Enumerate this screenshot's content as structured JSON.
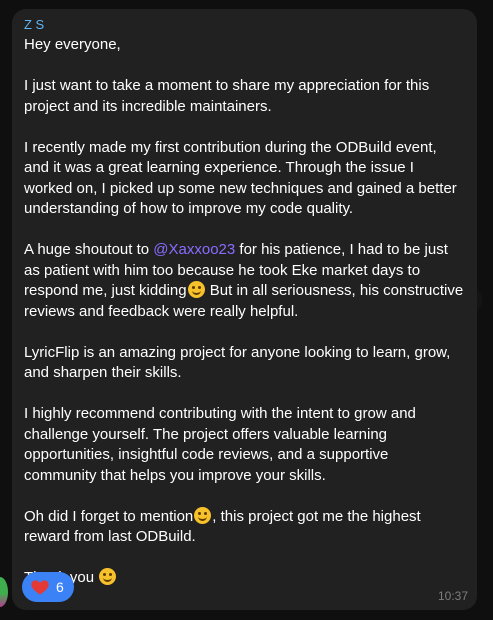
{
  "message": {
    "sender": "Z S",
    "paragraphs": {
      "p1": "Hey everyone,",
      "p2": "I just want to take a moment to share my appreciation for this project and its incredible maintainers.",
      "p3": "I recently made my first contribution during the ODBuild event, and it was a great learning experience. Through the issue I worked on, I picked up some new techniques and gained a better understanding of how to improve my code quality.",
      "p4_before": "A huge shoutout to ",
      "p4_mention": "@Xaxxoo23",
      "p4_middle": " for his patience, I had to be just as patient with him too because he took Eke market days to respond me, just kidding",
      "p4_after": " But in all seriousness, his constructive reviews and feedback were really helpful.",
      "p5": "LyricFlip is an amazing project for anyone looking to learn, grow, and sharpen their skills.",
      "p6": "I highly recommend contributing with the intent to grow and challenge yourself. The project offers valuable learning opportunities, insightful code reviews, and a supportive community that helps you improve your skills.",
      "p7_before": "Oh did I forget to mention",
      "p7_after": ", this project got me the highest reward from last ODBuild.",
      "p8": "Thank you "
    },
    "emojis": [
      "laughing-emoji",
      "hush-emoji",
      "smile-emoji"
    ],
    "reaction": {
      "icon": "heart-icon",
      "count": "6"
    },
    "time": "10:37"
  },
  "colors": {
    "background": "#0f0f0f",
    "bubble": "#212121",
    "sender": "#5eb5f7",
    "mention": "#8b6cff",
    "reaction": "#3b82f6",
    "heart": "#e53935"
  }
}
